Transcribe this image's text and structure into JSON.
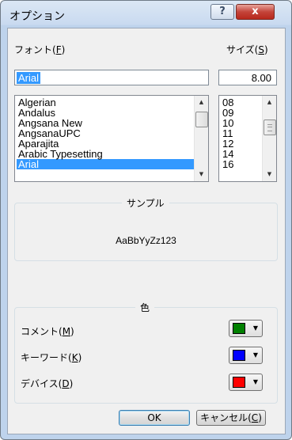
{
  "window": {
    "title": "オプション",
    "help_glyph": "?",
    "close_glyph": "x"
  },
  "font": {
    "label": "フォント(",
    "accel": "F",
    "label_end": ")",
    "value": "Arial",
    "items": [
      "Algerian",
      "Andalus",
      "Angsana New",
      "AngsanaUPC",
      "Aparajita",
      "Arabic Typesetting",
      "Arial"
    ],
    "selected_index": 6
  },
  "size": {
    "label": "サイズ(",
    "accel": "S",
    "label_end": ")",
    "value": "8.00",
    "items": [
      "08",
      "09",
      "10",
      "11",
      "12",
      "14",
      "16"
    ]
  },
  "sample": {
    "title": "サンプル",
    "text": "AaBbYyZz123"
  },
  "color_group": {
    "title": "色",
    "rows": [
      {
        "label": "コメント(",
        "accel": "M",
        "label_end": ")",
        "color": "#008000"
      },
      {
        "label": "キーワード(",
        "accel": "K",
        "label_end": ")",
        "color": "#0000ff"
      },
      {
        "label": "デバイス(",
        "accel": "D",
        "label_end": ")",
        "color": "#ff0000"
      }
    ]
  },
  "buttons": {
    "ok": "OK",
    "cancel": "キャンセル(",
    "cancel_accel": "C",
    "cancel_end": ")"
  }
}
